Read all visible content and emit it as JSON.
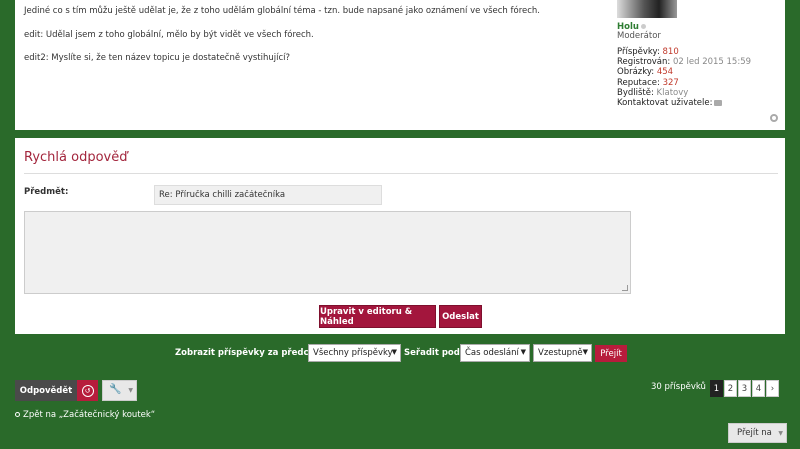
{
  "post": {
    "lines": [
      "Jediné co s tím můžu ještě udělat je, že z toho udělám globální téma - tzn. bude napsané jako oznámení ve všech fórech.",
      "edit: Udělal jsem z toho globální, mělo by být vidět ve všech fórech.",
      "edit2: Myslíte si, že ten název topicu je dostatečně vystihující?"
    ]
  },
  "profile": {
    "username": "Holu",
    "rank": "Moderátor",
    "stats": [
      {
        "label": "Příspěvky:",
        "value": "810"
      },
      {
        "label": "Registrován:",
        "value": "02 led 2015 15:59"
      },
      {
        "label": "Obrázky:",
        "value": "454"
      },
      {
        "label": "Reputace:",
        "value": "327"
      },
      {
        "label": "Bydliště:",
        "value": "Klatovy"
      }
    ],
    "contact_label": "Kontaktovat uživatele:"
  },
  "quick_reply": {
    "title": "Rychlá odpověď",
    "subject_label": "Předmět:",
    "subject_value": "Re: Příručka chilli začátečníka",
    "edit_button": "Upravit v editoru & Náhled",
    "send_button": "Odeslat"
  },
  "sort_bar": {
    "show_label": "Zobrazit příspěvky za předchozí:",
    "show_value": "Všechny příspěvky",
    "sort_label": "Seřadit podle",
    "sort_value": "Čas odeslání",
    "order_value": "Vzestupně",
    "go_button": "Přejít"
  },
  "actions": {
    "reply_button": "Odpovědět",
    "post_count": "30 příspěvků",
    "pages": [
      "1",
      "2",
      "3",
      "4"
    ],
    "next_icon": "›",
    "back_link": "Zpět na „Začátečnický koutek“",
    "jump_label": "Přejít na"
  }
}
